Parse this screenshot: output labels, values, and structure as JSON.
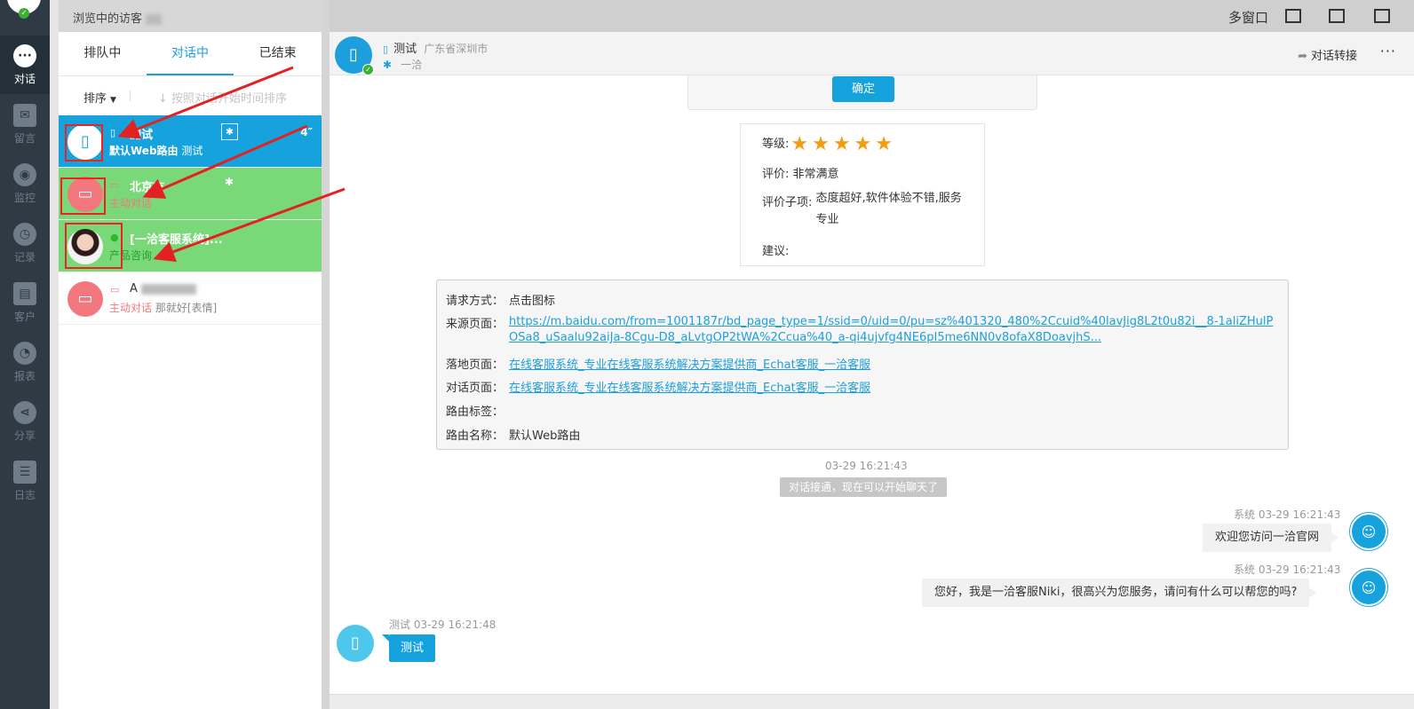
{
  "nav": {
    "items": [
      {
        "label": "对话",
        "icon": "chat-bubble-icon",
        "glyph": "···",
        "active": true
      },
      {
        "label": "留言",
        "icon": "envelope-icon",
        "glyph": "✉"
      },
      {
        "label": "监控",
        "icon": "eye-icon",
        "glyph": "◉"
      },
      {
        "label": "记录",
        "icon": "clock-icon",
        "glyph": "◷"
      },
      {
        "label": "客户",
        "icon": "contact-card-icon",
        "glyph": "▤"
      },
      {
        "label": "报表",
        "icon": "pie-chart-icon",
        "glyph": "◔"
      },
      {
        "label": "分享",
        "icon": "share-icon",
        "glyph": "⋖"
      },
      {
        "label": "日志",
        "icon": "clipboard-icon",
        "glyph": "☰"
      }
    ]
  },
  "list": {
    "header": "浏览中的访客",
    "tabs": [
      {
        "label": "排队中"
      },
      {
        "label": "对话中",
        "active": true
      },
      {
        "label": "已结束"
      }
    ],
    "sort_label": "排序",
    "sort_hint": "按照对话开始时间排序",
    "visitors": [
      {
        "name": "测试",
        "sub_a": "默认Web路由",
        "sub_b": "测试",
        "timer": "4″",
        "color": "blue"
      },
      {
        "name": "北京市",
        "sub_a": "主动对话",
        "sub_b": "",
        "color": "green"
      },
      {
        "name": "[一洽客服系统]...",
        "sub_a": "产品咨询",
        "sub_b": "",
        "color": "green"
      },
      {
        "name": "A",
        "sub_a": "主动对话",
        "sub_b": "那就好[表情]",
        "color": "white"
      }
    ]
  },
  "window": {
    "multi_window": "多窗口"
  },
  "chat_header": {
    "name": "测试",
    "location": "广东省深圳市",
    "source": "一洽",
    "transfer": "对话转接",
    "more": "···"
  },
  "confirm_button": "确定",
  "rating": {
    "level_label": "等级:",
    "stars": "★★★★★",
    "eval_label": "评价:",
    "eval_value": "非常满意",
    "sub_label": "评价子项:",
    "sub_value": "态度超好,软件体验不错,服务专业",
    "suggest_label": "建议:"
  },
  "info": {
    "request_label": "请求方式：",
    "request_value": "点击图标",
    "source_label": "来源页面：",
    "source_url": "https://m.baidu.com/from=1001187r/bd_page_type=1/ssid=0/uid=0/pu=sz%401320_480%2Ccuid%40lavJig8L2t0u82i__8-1aliZHulPOSa8_uSaalu92aiJa-8Cgu-D8_aLvtgOP2tWA%2Ccua%40_a-qi4ujvfg4NE6pI5me6NN0v8ofaX8DoavjhS...",
    "landing_label": "落地页面：",
    "landing_value": "在线客服系统_专业在线客服系统解决方案提供商_Echat客服_一洽客服",
    "dialog_label": "对话页面：",
    "dialog_value": "在线客服系统_专业在线客服系统解决方案提供商_Echat客服_一洽客服",
    "route_tag_label": "路由标签：",
    "route_name_label": "路由名称：",
    "route_name_value": "默认Web路由"
  },
  "messages": {
    "connect_time": "03-29 16:21:43",
    "connect_notice": "对话接通，现在可以开始聊天了",
    "sys1_meta": "系统  03-29 16:21:43",
    "sys1_text": "欢迎您访问一洽官网",
    "sys2_meta": "系统  03-29 16:21:43",
    "sys2_text": "您好，我是一洽客服Niki，很高兴为您服务，请问有什么可以帮您的吗?",
    "cust_meta": "测试  03-29 16:21:48",
    "cust_text": "测试"
  },
  "colors": {
    "accent": "#16a3dd",
    "active_green": "#79d979",
    "nav_bg": "#2f3a45",
    "star": "#f39c12",
    "annotation_red": "#e22222"
  }
}
